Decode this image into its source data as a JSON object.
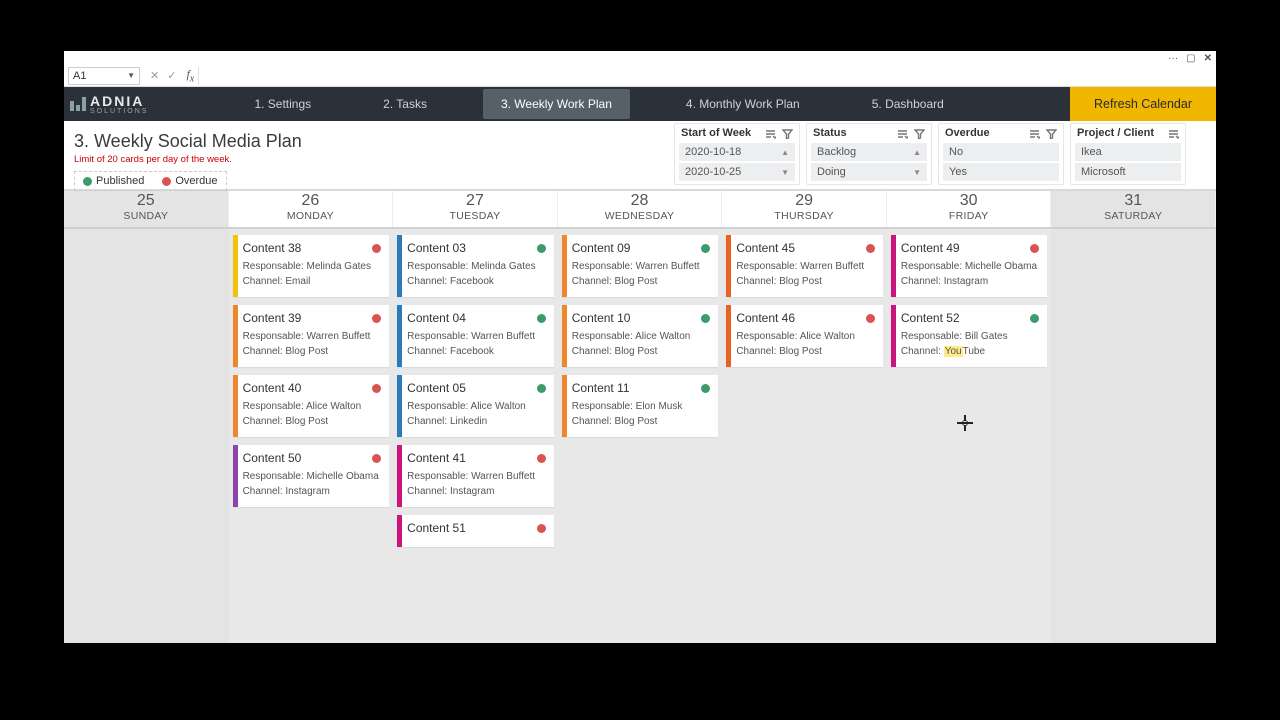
{
  "window": {
    "cell_ref": "A1"
  },
  "brand": {
    "name": "ADNIA",
    "sub": "SOLUTIONS"
  },
  "nav": {
    "items": [
      "1. Settings",
      "2. Tasks",
      "3. Weekly Work Plan",
      "4. Monthly Work Plan",
      "5. Dashboard"
    ],
    "active_index": 2,
    "refresh": "Refresh Calendar"
  },
  "page": {
    "title": "3. Weekly Social Media Plan",
    "limit_note": "Limit of 20 cards per day of the week.",
    "legend_published": "Published",
    "legend_overdue": "Overdue"
  },
  "filters": {
    "start_of_week": {
      "label": "Start of Week",
      "options": [
        "2020-10-18",
        "2020-10-25"
      ]
    },
    "status": {
      "label": "Status",
      "options": [
        "Backlog",
        "Doing"
      ]
    },
    "overdue": {
      "label": "Overdue",
      "options": [
        "No",
        "Yes"
      ]
    },
    "project": {
      "label": "Project / Client",
      "options": [
        "Ikea",
        "Microsoft"
      ]
    }
  },
  "days": [
    {
      "num": "25",
      "name": "SUNDAY",
      "dim": true
    },
    {
      "num": "26",
      "name": "MONDAY",
      "dim": false
    },
    {
      "num": "27",
      "name": "TUESDAY",
      "dim": false
    },
    {
      "num": "28",
      "name": "WEDNESDAY",
      "dim": false
    },
    {
      "num": "29",
      "name": "THURSDAY",
      "dim": false
    },
    {
      "num": "30",
      "name": "FRIDAY",
      "dim": false
    },
    {
      "num": "31",
      "name": "SATURDAY",
      "dim": true
    }
  ],
  "cards": {
    "1": [
      {
        "title": "Content 38",
        "resp": "Responsable: Melinda Gates",
        "chan": "Channel: Email",
        "stripe": "yellow",
        "dot": "red"
      },
      {
        "title": "Content 39",
        "resp": "Responsable: Warren Buffett",
        "chan": "Channel: Blog Post",
        "stripe": "orange",
        "dot": "red"
      },
      {
        "title": "Content 40",
        "resp": "Responsable: Alice Walton",
        "chan": "Channel: Blog Post",
        "stripe": "orange",
        "dot": "red"
      },
      {
        "title": "Content 50",
        "resp": "Responsable: Michelle Obama",
        "chan": "Channel: Instagram",
        "stripe": "purple",
        "dot": "red"
      }
    ],
    "2": [
      {
        "title": "Content 03",
        "resp": "Responsable: Melinda Gates",
        "chan": "Channel: Facebook",
        "stripe": "blue",
        "dot": "green"
      },
      {
        "title": "Content 04",
        "resp": "Responsable: Warren Buffett",
        "chan": "Channel: Facebook",
        "stripe": "blue",
        "dot": "green"
      },
      {
        "title": "Content 05",
        "resp": "Responsable: Alice Walton",
        "chan": "Channel: Linkedin",
        "stripe": "blue",
        "dot": "green"
      },
      {
        "title": "Content 41",
        "resp": "Responsable: Warren Buffett",
        "chan": "Channel: Instagram",
        "stripe": "magenta",
        "dot": "red"
      },
      {
        "title": "Content 51",
        "resp": "",
        "chan": "",
        "stripe": "magenta",
        "dot": "red",
        "short": true
      }
    ],
    "3": [
      {
        "title": "Content 09",
        "resp": "Responsable: Warren Buffett",
        "chan": "Channel: Blog Post",
        "stripe": "orange",
        "dot": "green"
      },
      {
        "title": "Content 10",
        "resp": "Responsable: Alice Walton",
        "chan": "Channel: Blog Post",
        "stripe": "orange",
        "dot": "green"
      },
      {
        "title": "Content 11",
        "resp": "Responsable: Elon Musk",
        "chan": "Channel: Blog Post",
        "stripe": "orange",
        "dot": "green"
      }
    ],
    "4": [
      {
        "title": "Content 45",
        "resp": "Responsable: Warren Buffett",
        "chan": "Channel: Blog Post",
        "stripe": "dorange",
        "dot": "red"
      },
      {
        "title": "Content 46",
        "resp": "Responsable: Alice Walton",
        "chan": "Channel: Blog Post",
        "stripe": "dorange",
        "dot": "red"
      }
    ],
    "5": [
      {
        "title": "Content 49",
        "resp": "Responsable: Michelle Obama",
        "chan": "Channel: Instagram",
        "stripe": "magenta",
        "dot": "red"
      },
      {
        "title": "Content 52",
        "resp": "Responsable: Bill Gates",
        "chan": "Channel: YouTube",
        "stripe": "magenta",
        "dot": "green",
        "hl": true
      }
    ]
  }
}
